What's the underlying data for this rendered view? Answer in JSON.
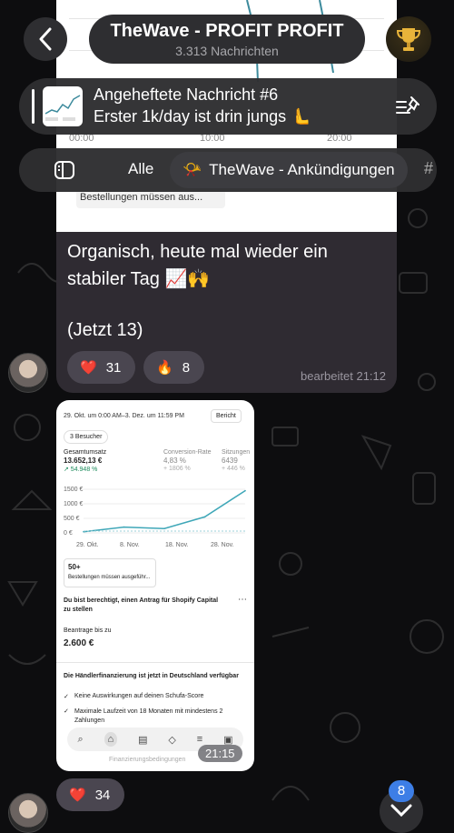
{
  "header": {
    "title": "TheWave - PROFIT PROFIT",
    "subtitle": "3.313 Nachrichten"
  },
  "pinned": {
    "title": "Angeheftete Nachricht #6",
    "text": "Erster 1k/day ist drin jungs 🫷"
  },
  "filter": {
    "all_label": "Alle",
    "announcements_label": "TheWave - Ankündigungen",
    "announcements_emoji": "📯"
  },
  "msg1": {
    "chart_ticks": [
      "00:00",
      "10:00",
      "20:00"
    ],
    "orders_label": "Bestellungen müssen aus...",
    "text": "Organisch, heute mal wieder ein stabiler Tag 📈🙌",
    "note": "(Jetzt 13)",
    "reactions": [
      {
        "emoji": "❤️",
        "count": "31"
      },
      {
        "emoji": "🔥",
        "count": "8"
      }
    ],
    "time": "bearbeitet 21:12"
  },
  "msg2": {
    "screenshot": {
      "date_range": "29. Okt. um 0:00 AM–3. Dez. um 11:59 PM",
      "report": "Bericht",
      "visitors": "3 Besucher",
      "total_sales_label": "Gesamtumsatz",
      "total_sales": "13.652,13 €",
      "total_sales_change": "↗ 54.948 %",
      "conversion_label": "Conversion-Rate",
      "conversion": "4,83 %",
      "conversion_change": "+ 1806 %",
      "sessions_label": "Sitzungen",
      "sessions": "6439",
      "sessions_change": "+ 446 %",
      "y_ticks": [
        "1500 €",
        "1000 €",
        "500 €",
        "0 €"
      ],
      "x_ticks": [
        "29. Okt.",
        "8. Nov.",
        "18. Nov.",
        "28. Nov."
      ],
      "orders_count": "50+",
      "orders_text": "Bestellungen müssen ausgeführ...",
      "capital_title": "Du bist berechtigt, einen Antrag für Shopify Capital zu stellen",
      "apply_label": "Beantrage bis zu",
      "apply_amount": "2.600 €",
      "financing_title": "Die Händlerfinanzierung ist jetzt in Deutschland verfügbar",
      "check1": "Keine Auswirkungen auf deinen Schufa-Score",
      "check2": "Maximale Laufzeit von 18 Monaten mit mindestens 2 Zahlungen",
      "footer": "Finanzierungsbedingungen"
    },
    "time": "21:15",
    "reaction": {
      "emoji": "❤️",
      "count": "34"
    }
  },
  "unread_badge": "8",
  "chart_data": {
    "type": "line",
    "title": "Gesamtumsatz",
    "xlabel": "",
    "ylabel": "",
    "categories": [
      "29. Okt.",
      "8. Nov.",
      "18. Nov.",
      "28. Nov.",
      "3. Dez."
    ],
    "values": [
      40,
      200,
      150,
      550,
      1450
    ],
    "ylim": [
      0,
      1500
    ]
  }
}
